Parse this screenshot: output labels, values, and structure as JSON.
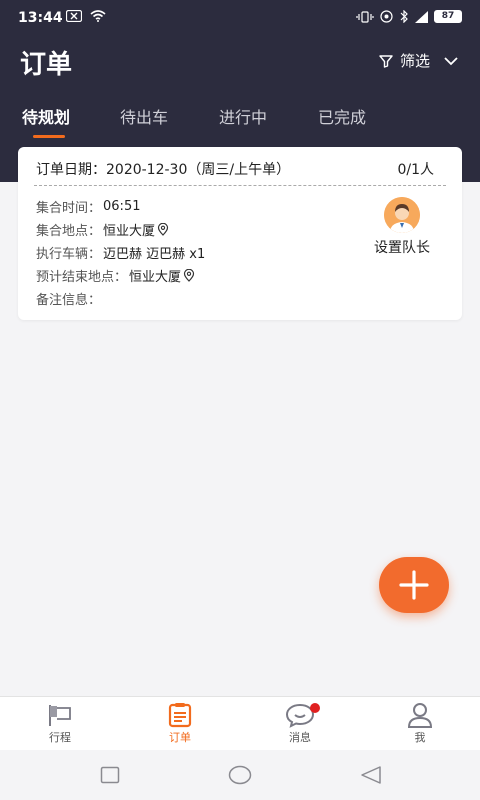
{
  "status": {
    "time": "13:44",
    "battery": "87"
  },
  "header": {
    "title": "订单",
    "filter_label": "筛选"
  },
  "tabs": [
    {
      "label": "待规划"
    },
    {
      "label": "待出车"
    },
    {
      "label": "进行中"
    },
    {
      "label": "已完成"
    }
  ],
  "order": {
    "date_label": "订单日期：",
    "date_value": "2020-12-30（周三/上午单）",
    "count": "0/1人",
    "rows": [
      {
        "label": "集合时间：",
        "value": "06:51"
      },
      {
        "label": "集合地点：",
        "value": "恒业大厦"
      },
      {
        "label": "执行车辆：",
        "value": "迈巴赫 迈巴赫 x1"
      },
      {
        "label": "预计结束地点：",
        "value": "恒业大厦"
      },
      {
        "label": "备注信息：",
        "value": ""
      }
    ],
    "set_leader_label": "设置队长"
  },
  "bottom_nav": [
    {
      "label": "行程",
      "icon": "flag-icon"
    },
    {
      "label": "订单",
      "icon": "clipboard-icon"
    },
    {
      "label": "消息",
      "icon": "chat-icon"
    },
    {
      "label": "我",
      "icon": "person-icon"
    }
  ],
  "colors": {
    "header_bg": "#2c2c3e",
    "accent": "#f26b1d",
    "badge": "#e02020"
  }
}
